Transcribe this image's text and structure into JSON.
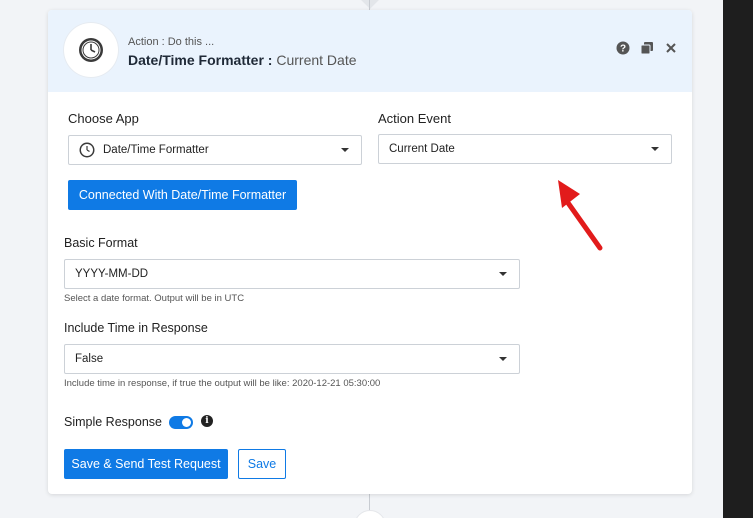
{
  "header": {
    "action_label": "Action : Do this ...",
    "title": "Date/Time Formatter :",
    "subtitle": "Current Date"
  },
  "choose_app": {
    "label": "Choose App",
    "value": "Date/Time Formatter"
  },
  "action_event": {
    "label": "Action Event",
    "value": "Current Date"
  },
  "connected_button": "Connected With Date/Time Formatter",
  "basic_format": {
    "label": "Basic Format",
    "value": "YYYY-MM-DD",
    "hint": "Select a date format. Output will be in UTC"
  },
  "include_time": {
    "label": "Include Time in Response",
    "value": "False",
    "hint": "Include time in response, if true the output will be like: 2020-12-21 05:30:00"
  },
  "simple_response": {
    "label": "Simple Response",
    "enabled": true
  },
  "buttons": {
    "save_send": "Save & Send Test Request",
    "save": "Save"
  },
  "colors": {
    "accent": "#0f7ae5",
    "header_bg": "#eaf3fd",
    "annotation_arrow": "#e21b1b"
  },
  "icons": {
    "app": "clock-icon",
    "help": "help-icon",
    "copy": "copy-icon",
    "close": "close-icon",
    "info": "info-icon"
  }
}
